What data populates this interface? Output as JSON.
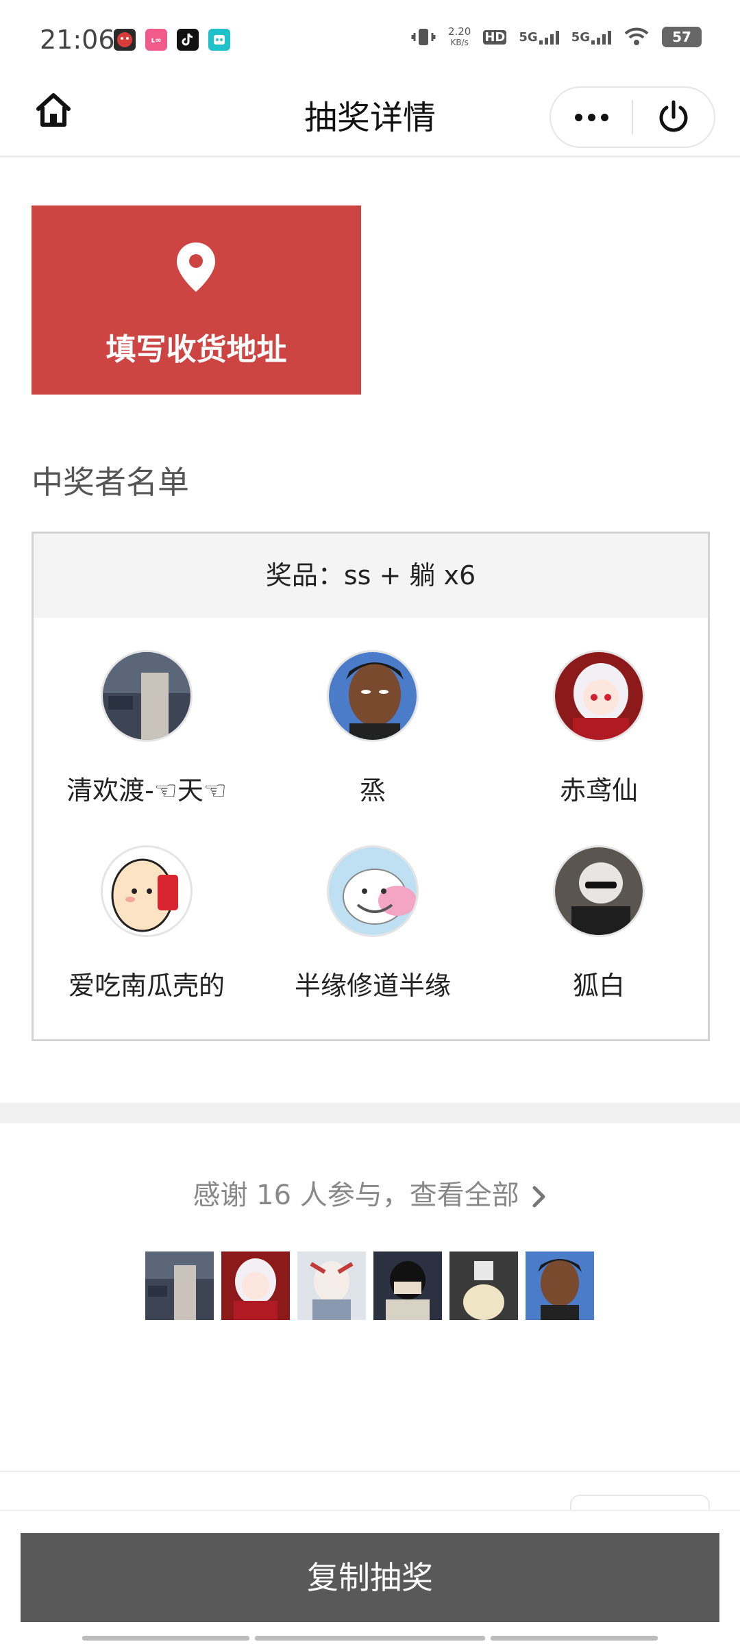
{
  "status_bar": {
    "time": "21:06",
    "net_speed": "2.20",
    "net_speed_unit": "KB/s",
    "hd": "HD",
    "sim1": "5G",
    "sim2": "5G",
    "battery": "57",
    "icons": [
      "app-icon-red-mascot",
      "app-icon-pink",
      "tiktok-icon",
      "app-icon-teal",
      "vibrate-icon",
      "wifi-icon"
    ]
  },
  "nav": {
    "title": "抽奖详情",
    "icons": [
      "home-icon",
      "more-icon",
      "power-icon"
    ]
  },
  "address_card": {
    "label": "填写收货地址",
    "icon": "location-pin-icon",
    "color": "#cd4543"
  },
  "winners": {
    "section_title": "中奖者名单",
    "prize": "奖品：ss + 躺 x6",
    "list": [
      {
        "name": "清欢渡-☜天☜"
      },
      {
        "name": "烝"
      },
      {
        "name": "赤鸢仙"
      },
      {
        "name": "爱吃南瓜壳的"
      },
      {
        "name": "半缘修道半缘"
      },
      {
        "name": "狐白"
      }
    ]
  },
  "participants": {
    "thanks_text": "感谢 16 人参与，查看全部",
    "icon": "chevron-right-icon",
    "thumb_count": 6
  },
  "footer": {
    "copy_label": "复制抽奖",
    "button_color": "#595959"
  }
}
